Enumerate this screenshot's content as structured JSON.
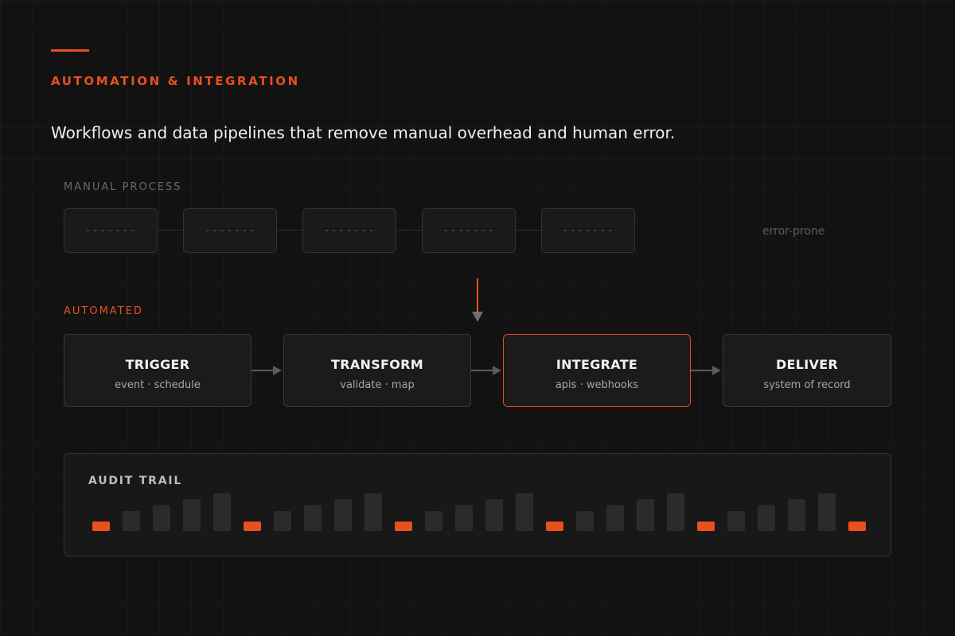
{
  "header": {
    "eyebrow": "AUTOMATION & INTEGRATION",
    "headline": "Workflows and data pipelines that remove manual overhead and human error."
  },
  "manual": {
    "label": "MANUAL PROCESS",
    "placeholder": "-------",
    "box_count": 5,
    "note": "error-prone"
  },
  "automated": {
    "label": "AUTOMATED",
    "stages": [
      {
        "title": "TRIGGER",
        "subtitle": "event · schedule",
        "active": false
      },
      {
        "title": "TRANSFORM",
        "subtitle": "validate · map",
        "active": false
      },
      {
        "title": "INTEGRATE",
        "subtitle": "apis · webhooks",
        "active": true
      },
      {
        "title": "DELIVER",
        "subtitle": "system of record",
        "active": false
      }
    ]
  },
  "audit": {
    "title": "AUDIT TRAIL",
    "event_levels": [
      1,
      2,
      3,
      4,
      5,
      1,
      2,
      3,
      4,
      5,
      1,
      2,
      3,
      4,
      5,
      1,
      2,
      3,
      4,
      5,
      1,
      2,
      3,
      4,
      5,
      1
    ],
    "highlight_every": 5
  },
  "colors": {
    "accent": "#e8501e",
    "background": "#121212",
    "bar": "#2b2b2b",
    "box_border": "#383838",
    "connector": "#555555"
  }
}
